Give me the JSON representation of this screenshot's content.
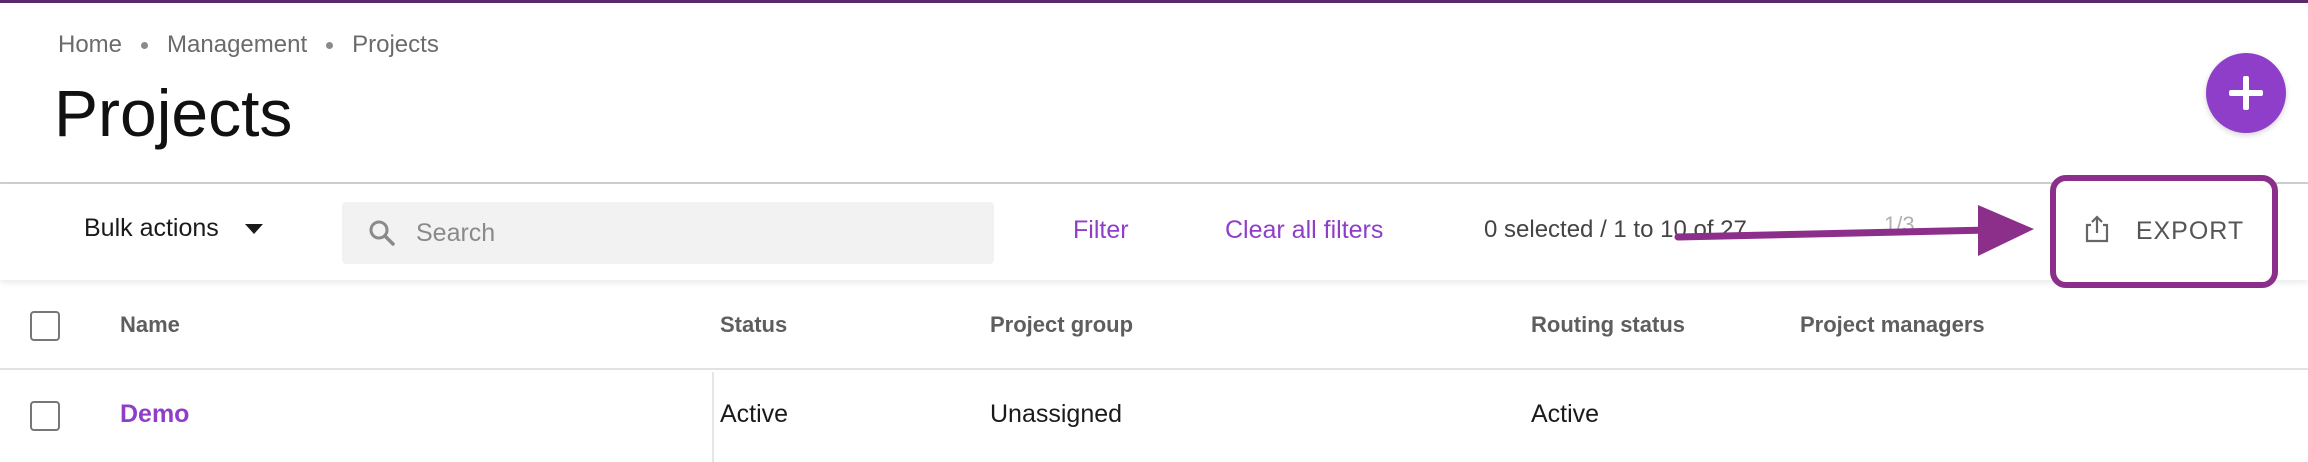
{
  "breadcrumb": [
    "Home",
    "Management",
    "Projects"
  ],
  "page_title": "Projects",
  "toolbar": {
    "bulk_actions": "Bulk actions",
    "search_placeholder": "Search",
    "filter": "Filter",
    "clear_filters": "Clear all filters",
    "selection_count": "0 selected / 1 to 10 of 27",
    "page_indicator": "1/3",
    "export": "EXPORT"
  },
  "table": {
    "columns": [
      "Name",
      "Status",
      "Project group",
      "Routing status",
      "Project managers"
    ],
    "rows": [
      {
        "name": "Demo",
        "status": "Active",
        "project_group": "Unassigned",
        "routing_status": "Active",
        "project_managers": ""
      }
    ]
  },
  "colors": {
    "accent": "#8f3ec9",
    "annotation": "#8b2f8a"
  },
  "icons": {
    "add": "plus-icon",
    "search": "search-icon",
    "export": "share-export-icon",
    "bulk_caret": "caret-down-icon"
  }
}
